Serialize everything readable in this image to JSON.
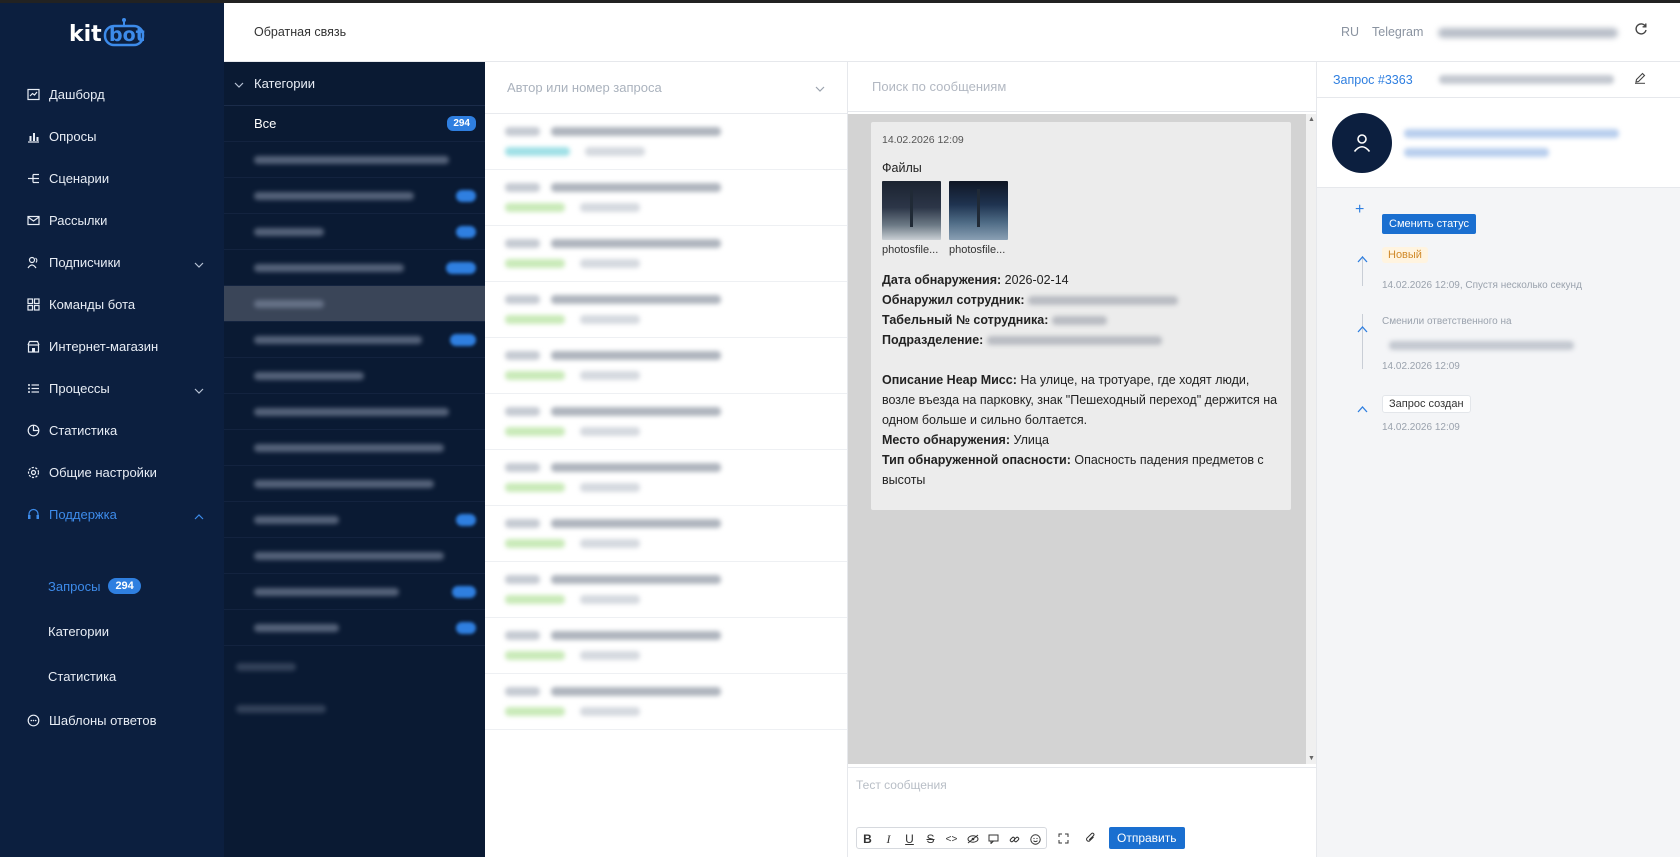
{
  "app": {
    "logo_text": "kitbot"
  },
  "header": {
    "title": "Обратная связь",
    "lang": "RU",
    "telegram": "Telegram"
  },
  "sidebar": {
    "items": [
      {
        "label": "Дашборд",
        "icon": "dashboard-icon"
      },
      {
        "label": "Опросы",
        "icon": "bar-chart-icon"
      },
      {
        "label": "Сценарии",
        "icon": "scenario-icon"
      },
      {
        "label": "Рассылки",
        "icon": "mail-icon"
      },
      {
        "label": "Подписчики",
        "icon": "users-icon"
      },
      {
        "label": "Команды бота",
        "icon": "grid-icon"
      },
      {
        "label": "Интернет-магазин",
        "icon": "store-icon"
      },
      {
        "label": "Процессы",
        "icon": "list-icon"
      },
      {
        "label": "Статистика",
        "icon": "pie-chart-icon"
      },
      {
        "label": "Общие настройки",
        "icon": "gear-icon"
      },
      {
        "label": "Поддержка",
        "icon": "headset-icon"
      },
      {
        "label": "Шаблоны ответов",
        "icon": "chat-icon"
      }
    ],
    "support_sub": [
      {
        "label": "Запросы",
        "badge": "294"
      },
      {
        "label": "Категории"
      },
      {
        "label": "Статистика"
      }
    ]
  },
  "categories": {
    "header": "Категории",
    "all_label": "Все",
    "all_count": "294"
  },
  "list": {
    "search_placeholder": "Автор или номер запроса"
  },
  "chat": {
    "search_placeholder": "Поиск по сообщениям",
    "message": {
      "time": "14.02.2026 12:09",
      "files_label": "Файлы",
      "files": [
        "photosfile...",
        "photosfile..."
      ],
      "detect_date_label": "Дата обнаружения:",
      "detect_date_value": "2026-02-14",
      "employee_label": "Обнаружил сотрудник:",
      "tab_label": "Табельный № сотрудника:",
      "dept_label": "Подразделение:",
      "desc_label": "Описание Неар Мисс:",
      "desc_value": "На улице, на тротуаре, где ходят люди, возле въезда на парковку, знак \"Пешеходный переход\" держится на одном больше и сильно болтается.",
      "place_label": "Место обнаружения:",
      "place_value": "Улица",
      "hazard_label": "Тип обнаруженной опасности:",
      "hazard_value": "Опасность падения предметов с высоты"
    },
    "compose_placeholder": "Тест сообщения",
    "send_label": "Отправить"
  },
  "right": {
    "request_title": "Запрос #3363",
    "change_status": "Сменить статус",
    "timeline": [
      {
        "tag": "Новый",
        "time": "14.02.2026 12:09, Спустя несколько секунд"
      },
      {
        "text": "Сменили ответственного на",
        "time": "14.02.2026 12:09"
      },
      {
        "tag": "Запрос создан",
        "time": "14.02.2026 12:09"
      }
    ]
  },
  "colors": {
    "sidebar": "#0c1f3f",
    "accent": "#2f7fe0",
    "active_nav": "#3d8bea"
  }
}
